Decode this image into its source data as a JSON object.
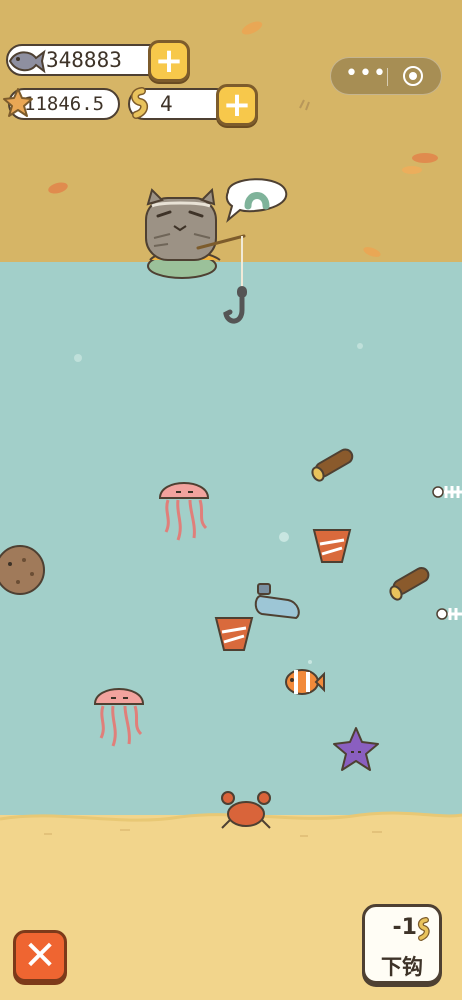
{
  "currency": {
    "fish_count": "348883",
    "star_count": "11846.5",
    "worm_count": "4"
  },
  "menu": {
    "more_glyph": "•••"
  },
  "actions": {
    "drop_hook_cost": "-1",
    "drop_hook_label": "下钩",
    "close_glyph": "✕",
    "plus_glyph": "+"
  },
  "icons": [
    "fish-icon",
    "starfish-icon",
    "worm-icon",
    "plus-icon",
    "more-icon",
    "target-icon",
    "close-icon",
    "hook-icon"
  ],
  "colors": {
    "sky": "#d6b566",
    "water": "#a2cfc9",
    "sand": "#f2d58c",
    "plus_button": "#f7c84b",
    "close_button": "#ef6531"
  }
}
